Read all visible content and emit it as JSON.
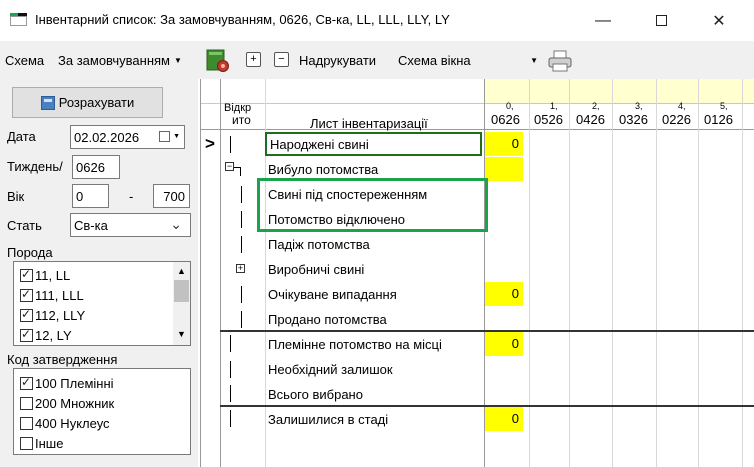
{
  "window": {
    "title": "Інвентарний список: За замовчуванням, 0626, Св-ка, LL, LLL, LLY, LY",
    "minimize": "—",
    "close": "✕"
  },
  "toolbar": {
    "scheme_label": "Схема",
    "scheme_value": "За замовчуванням",
    "print_label": "Надрукувати",
    "window_scheme": "Схема вікна",
    "btn_expand": "+",
    "btn_collapse": "−"
  },
  "left": {
    "calc_button": "Розрахувати",
    "date_label": "Дата",
    "date_value": "02.02.2026",
    "week_label": "Тиждень/",
    "week_value": "0626",
    "age_label": "Вік",
    "age_from": "0",
    "age_dash": "-",
    "age_to": "700",
    "status_label": "Стать",
    "status_value": "Св-ка",
    "breed_label": "Порода",
    "breeds": [
      {
        "label": "11, LL",
        "checked": true
      },
      {
        "label": "111, LLL",
        "checked": true
      },
      {
        "label": "112, LLY",
        "checked": true
      },
      {
        "label": "12, LY",
        "checked": true
      }
    ],
    "code_label": "Код затвердження",
    "codes": [
      {
        "label": "100 Племінні",
        "checked": true
      },
      {
        "label": "200 Множник",
        "checked": false
      },
      {
        "label": "400 Нуклеус",
        "checked": false
      },
      {
        "label": "Інше",
        "checked": false
      }
    ]
  },
  "grid": {
    "header": {
      "col_open_top": "Відкр",
      "col_open_bottom": "ито",
      "col_name": "Лист інвентаризації"
    },
    "weeks": [
      {
        "top": "0,",
        "label": "0626"
      },
      {
        "top": "1,",
        "label": "0526"
      },
      {
        "top": "2,",
        "label": "0426"
      },
      {
        "top": "3,",
        "label": "0326"
      },
      {
        "top": "4,",
        "label": "0226"
      },
      {
        "top": "5,",
        "label": "0126"
      }
    ],
    "current_row_marker": ">",
    "rows": [
      {
        "name": "Народжені свині",
        "value": "0"
      },
      {
        "name": "Вибуло потомства",
        "value": ""
      },
      {
        "name": "Свині під спостереженням",
        "value": null
      },
      {
        "name": "Потомство відключено",
        "value": null
      },
      {
        "name": "Падіж потомства",
        "value": null
      },
      {
        "name": "Виробничі свині",
        "value": null
      },
      {
        "name": "Очікуване випадання",
        "value": "0"
      },
      {
        "name": "Продано потомства",
        "value": null
      },
      {
        "name": "Племінне потомство на місці",
        "value": "0"
      },
      {
        "name": "Необхідний залишок",
        "value": null
      },
      {
        "name": "Всього вибрано",
        "value": null
      },
      {
        "name": "Залишилися в стаді",
        "value": "0"
      }
    ]
  },
  "colors": {
    "yellow": "#ffff00",
    "header_yellow": "#ffffd0",
    "highlight_green": "#1aa34a"
  }
}
